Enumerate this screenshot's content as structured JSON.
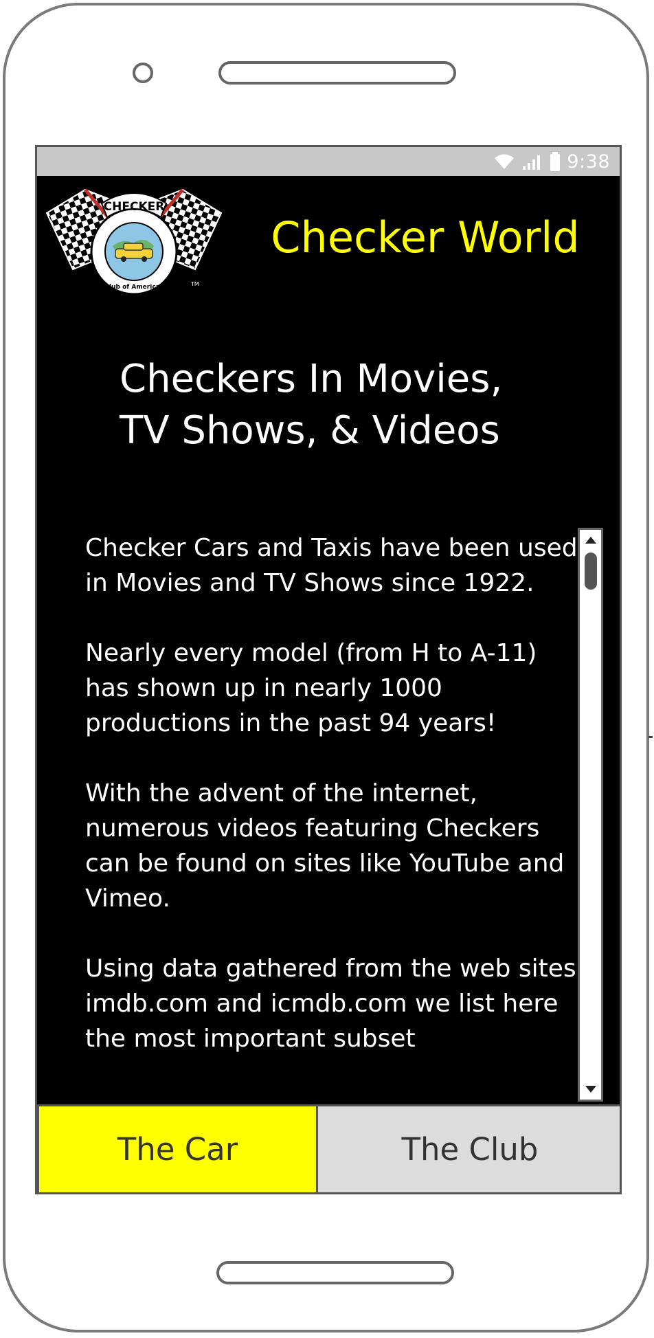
{
  "status_bar": {
    "time": "9:38",
    "icons": [
      "wifi-icon",
      "signal-icon",
      "battery-icon"
    ]
  },
  "header": {
    "app_title": "Checker World",
    "logo": {
      "icon": "checker-club-logo",
      "banner_text": "CHECKER",
      "ring_text": "Car Club of America, Inc.",
      "tm": "TM"
    }
  },
  "page": {
    "heading_line1": "Checkers In Movies,",
    "heading_line2": "TV Shows, & Videos",
    "paragraphs": [
      "Checker Cars and Taxis have been used in Movies and TV Shows since 1922.",
      "Nearly every model (from H to A-11) has shown up in nearly 1000 productions in the past 94 years!",
      "With the advent of the internet, numerous videos featuring Checkers can be found on sites like YouTube and Vimeo.",
      "Using data gathered from the web sites imdb.com and icmdb.com we list here the most important subset"
    ]
  },
  "tabs": [
    {
      "label": "The Car",
      "active": true
    },
    {
      "label": "The Club",
      "active": false
    }
  ],
  "colors": {
    "accent": "#ffff00",
    "background": "#000000",
    "tab_inactive": "#dcdcdc",
    "status_bar": "#c8c8c8"
  }
}
